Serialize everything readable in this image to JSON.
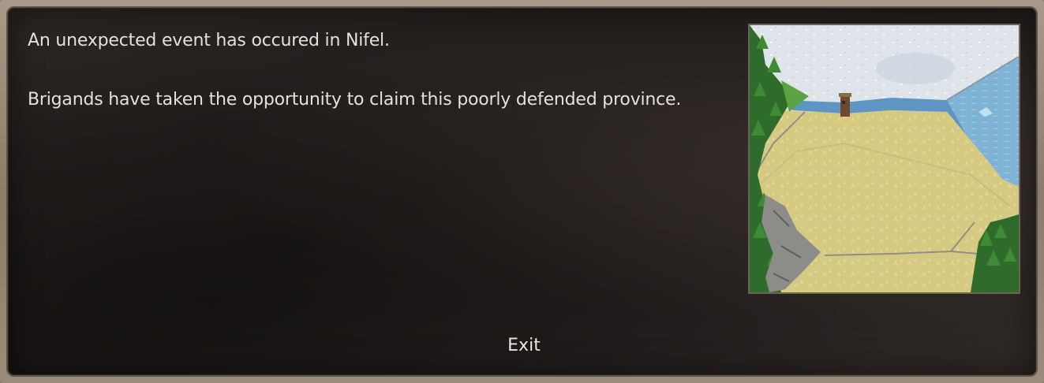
{
  "event": {
    "line1": "An unexpected event has occured in Nifel.",
    "line2": "Brigands have taken the opportunity to claim this poorly defended province.",
    "exit_label": "Exit"
  },
  "image": {
    "icon": "province-map-illustration"
  }
}
